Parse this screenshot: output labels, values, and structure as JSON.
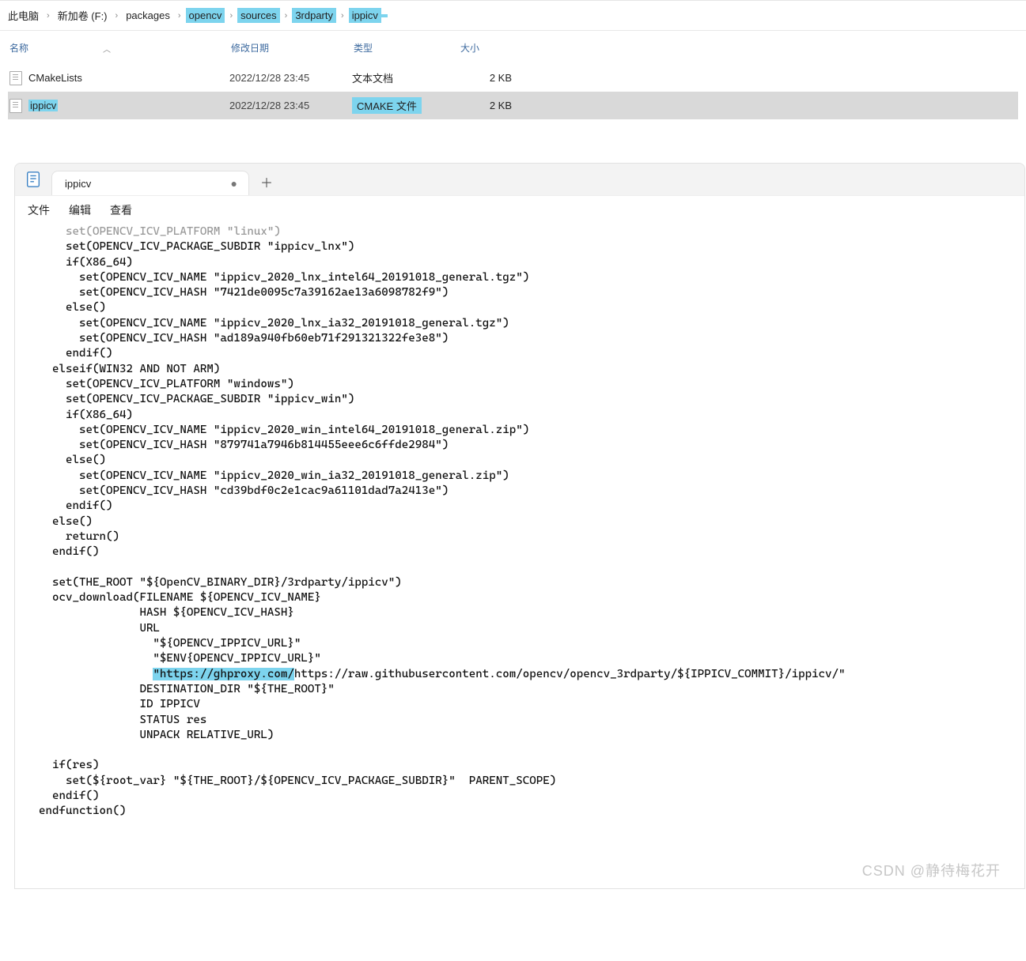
{
  "breadcrumbs": {
    "items": [
      {
        "label": "此电脑",
        "hl": false
      },
      {
        "label": "新加卷 (F:)",
        "hl": false
      },
      {
        "label": "packages",
        "hl": false
      },
      {
        "label": "opencv",
        "hl": true
      },
      {
        "label": "sources",
        "hl": true
      },
      {
        "label": "3rdparty",
        "hl": true
      },
      {
        "label": "ippicv",
        "hl": true
      }
    ],
    "trailing_hl_pad": "      "
  },
  "columns": {
    "name": "名称",
    "date": "修改日期",
    "type": "类型",
    "size": "大小"
  },
  "files": [
    {
      "name": "CMakeLists",
      "name_hl": false,
      "date": "2022/12/28 23:45",
      "type": "文本文档",
      "type_hl": false,
      "size": "2 KB",
      "selected": false
    },
    {
      "name": "ippicv",
      "name_hl": true,
      "date": "2022/12/28 23:45",
      "type": "CMAKE 文件",
      "type_hl": true,
      "size": "2 KB",
      "selected": true
    }
  ],
  "editor": {
    "tab_title": "ippicv",
    "menu": [
      "文件",
      "编辑",
      "查看"
    ]
  },
  "code_lines": [
    {
      "indent": 4,
      "prefix": "set(OPENCV_ICV_PLATFORM \"linux\")",
      "cls": "cutoff"
    },
    {
      "indent": 4,
      "prefix": "set(OPENCV_ICV_PACKAGE_SUBDIR \"ippicv_lnx\")"
    },
    {
      "indent": 4,
      "prefix": "if(X86_64)"
    },
    {
      "indent": 6,
      "prefix": "set(OPENCV_ICV_NAME \"ippicv_2020_lnx_intel64_20191018_general.tgz\")"
    },
    {
      "indent": 6,
      "prefix": "set(OPENCV_ICV_HASH \"7421de0095c7a39162ae13a6098782f9\")"
    },
    {
      "indent": 4,
      "prefix": "else()"
    },
    {
      "indent": 6,
      "prefix": "set(OPENCV_ICV_NAME \"ippicv_2020_lnx_ia32_20191018_general.tgz\")"
    },
    {
      "indent": 6,
      "prefix": "set(OPENCV_ICV_HASH \"ad189a940fb60eb71f291321322fe3e8\")"
    },
    {
      "indent": 4,
      "prefix": "endif()"
    },
    {
      "indent": 2,
      "prefix": "elseif(WIN32 AND NOT ARM)"
    },
    {
      "indent": 4,
      "prefix": "set(OPENCV_ICV_PLATFORM \"windows\")"
    },
    {
      "indent": 4,
      "prefix": "set(OPENCV_ICV_PACKAGE_SUBDIR \"ippicv_win\")"
    },
    {
      "indent": 4,
      "prefix": "if(X86_64)"
    },
    {
      "indent": 6,
      "prefix": "set(OPENCV_ICV_NAME \"ippicv_2020_win_intel64_20191018_general.zip\")"
    },
    {
      "indent": 6,
      "prefix": "set(OPENCV_ICV_HASH \"879741a7946b814455eee6c6ffde2984\")"
    },
    {
      "indent": 4,
      "prefix": "else()"
    },
    {
      "indent": 6,
      "prefix": "set(OPENCV_ICV_NAME \"ippicv_2020_win_ia32_20191018_general.zip\")"
    },
    {
      "indent": 6,
      "prefix": "set(OPENCV_ICV_HASH \"cd39bdf0c2e1cac9a61101dad7a2413e\")"
    },
    {
      "indent": 4,
      "prefix": "endif()"
    },
    {
      "indent": 2,
      "prefix": "else()"
    },
    {
      "indent": 4,
      "prefix": "return()"
    },
    {
      "indent": 2,
      "prefix": "endif()"
    },
    {
      "indent": 0,
      "prefix": ""
    },
    {
      "indent": 2,
      "prefix": "set(THE_ROOT \"${OpenCV_BINARY_DIR}/3rdparty/ippicv\")"
    },
    {
      "indent": 2,
      "prefix": "ocv_download(FILENAME ${OPENCV_ICV_NAME}"
    },
    {
      "indent": 15,
      "prefix": "HASH ${OPENCV_ICV_HASH}"
    },
    {
      "indent": 15,
      "prefix": "URL"
    },
    {
      "indent": 17,
      "prefix": "\"${OPENCV_IPPICV_URL}\""
    },
    {
      "indent": 17,
      "prefix": "\"$ENV{OPENCV_IPPICV_URL}\""
    },
    {
      "indent": 17,
      "prefix": "",
      "hl": "\"https://ghproxy.com/",
      "suffix": "https://raw.githubusercontent.com/opencv/opencv_3rdparty/${IPPICV_COMMIT}/ippicv/\""
    },
    {
      "indent": 15,
      "prefix": "DESTINATION_DIR \"${THE_ROOT}\""
    },
    {
      "indent": 15,
      "prefix": "ID IPPICV"
    },
    {
      "indent": 15,
      "prefix": "STATUS res"
    },
    {
      "indent": 15,
      "prefix": "UNPACK RELATIVE_URL)"
    },
    {
      "indent": 0,
      "prefix": ""
    },
    {
      "indent": 2,
      "prefix": "if(res)"
    },
    {
      "indent": 4,
      "prefix": "set(${root_var} \"${THE_ROOT}/${OPENCV_ICV_PACKAGE_SUBDIR}\"  PARENT_SCOPE)"
    },
    {
      "indent": 2,
      "prefix": "endif()"
    },
    {
      "indent": 0,
      "prefix": "endfunction()"
    }
  ],
  "watermark": "CSDN @静待梅花开"
}
